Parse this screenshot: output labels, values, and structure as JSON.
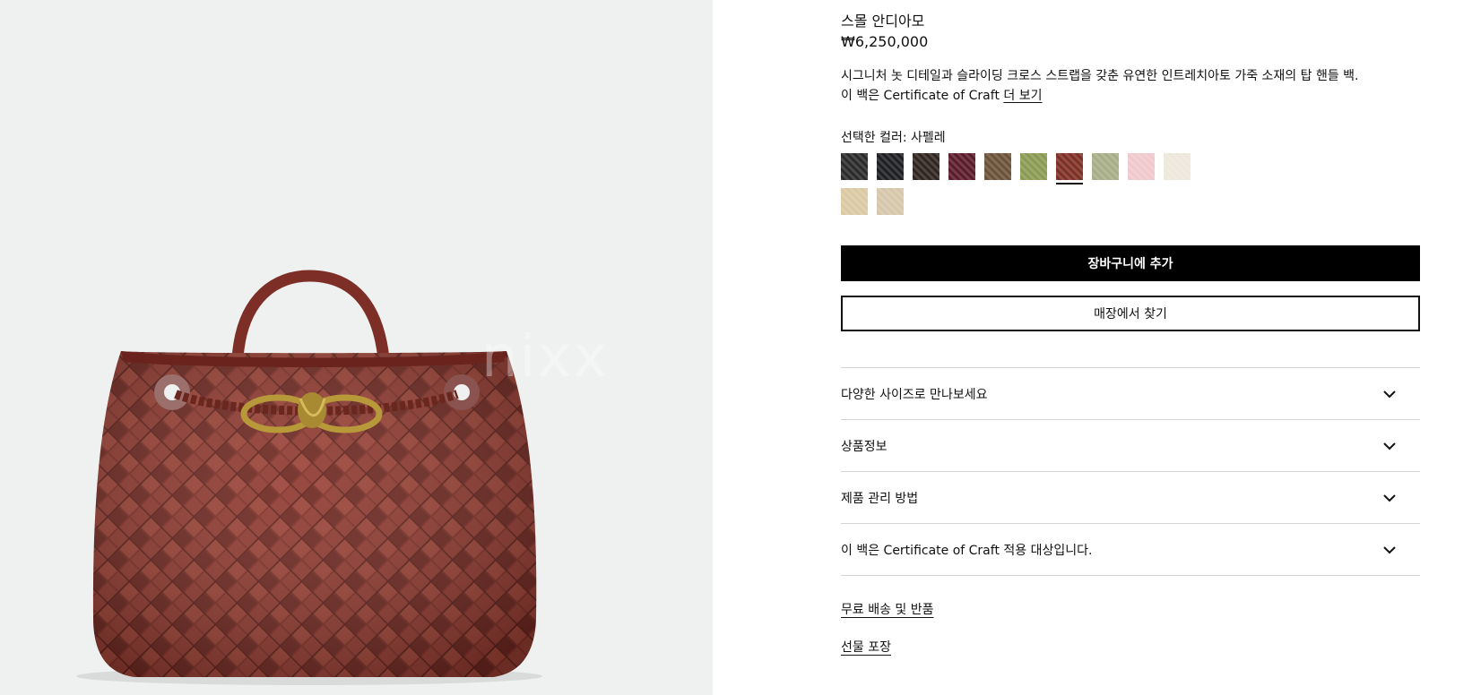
{
  "product": {
    "title": "스몰 안디아모",
    "price": "₩6,250,000",
    "description_line1": "시그니처 놋 디테일과 슬라이딩 크로스 스트랩을 갖춘 유연한 인트레치아토 가죽 소재의 탑 핸들 백.",
    "description_line2_prefix": "이 백은 Certificate of Craft ",
    "more_link": "더 보기",
    "selected_color_label": "선택한 컬러: 사펠레"
  },
  "image": {
    "watermark": "nixx"
  },
  "swatches": [
    {
      "name": "swatch-1",
      "color": "#2a2a2a"
    },
    {
      "name": "swatch-2",
      "color": "#1e1f22"
    },
    {
      "name": "swatch-3",
      "color": "#2f2420"
    },
    {
      "name": "swatch-4",
      "color": "#5a1c2a"
    },
    {
      "name": "swatch-5",
      "color": "#6b5238"
    },
    {
      "name": "swatch-6",
      "color": "#8a9a52"
    },
    {
      "name": "swatch-7",
      "color": "#7e2f25",
      "selected": true
    },
    {
      "name": "swatch-8",
      "color": "#a7ad86"
    },
    {
      "name": "swatch-9",
      "color": "#f1c8cc"
    },
    {
      "name": "swatch-10",
      "color": "#ede7dc"
    },
    {
      "name": "swatch-11",
      "color": "#dac9a2"
    },
    {
      "name": "swatch-12",
      "color": "#d6c7ab"
    }
  ],
  "buttons": {
    "add_to_cart": "장바구니에 추가",
    "find_in_store": "매장에서 찾기"
  },
  "accordion": [
    {
      "label": "다양한 사이즈로 만나보세요"
    },
    {
      "label": "상품정보"
    },
    {
      "label": "제품 관리 방법"
    },
    {
      "label": "이 백은 Certificate of Craft 적용 대상입니다."
    }
  ],
  "links": {
    "shipping": "무료 배송 및 반품",
    "gift": "선물 포장"
  }
}
